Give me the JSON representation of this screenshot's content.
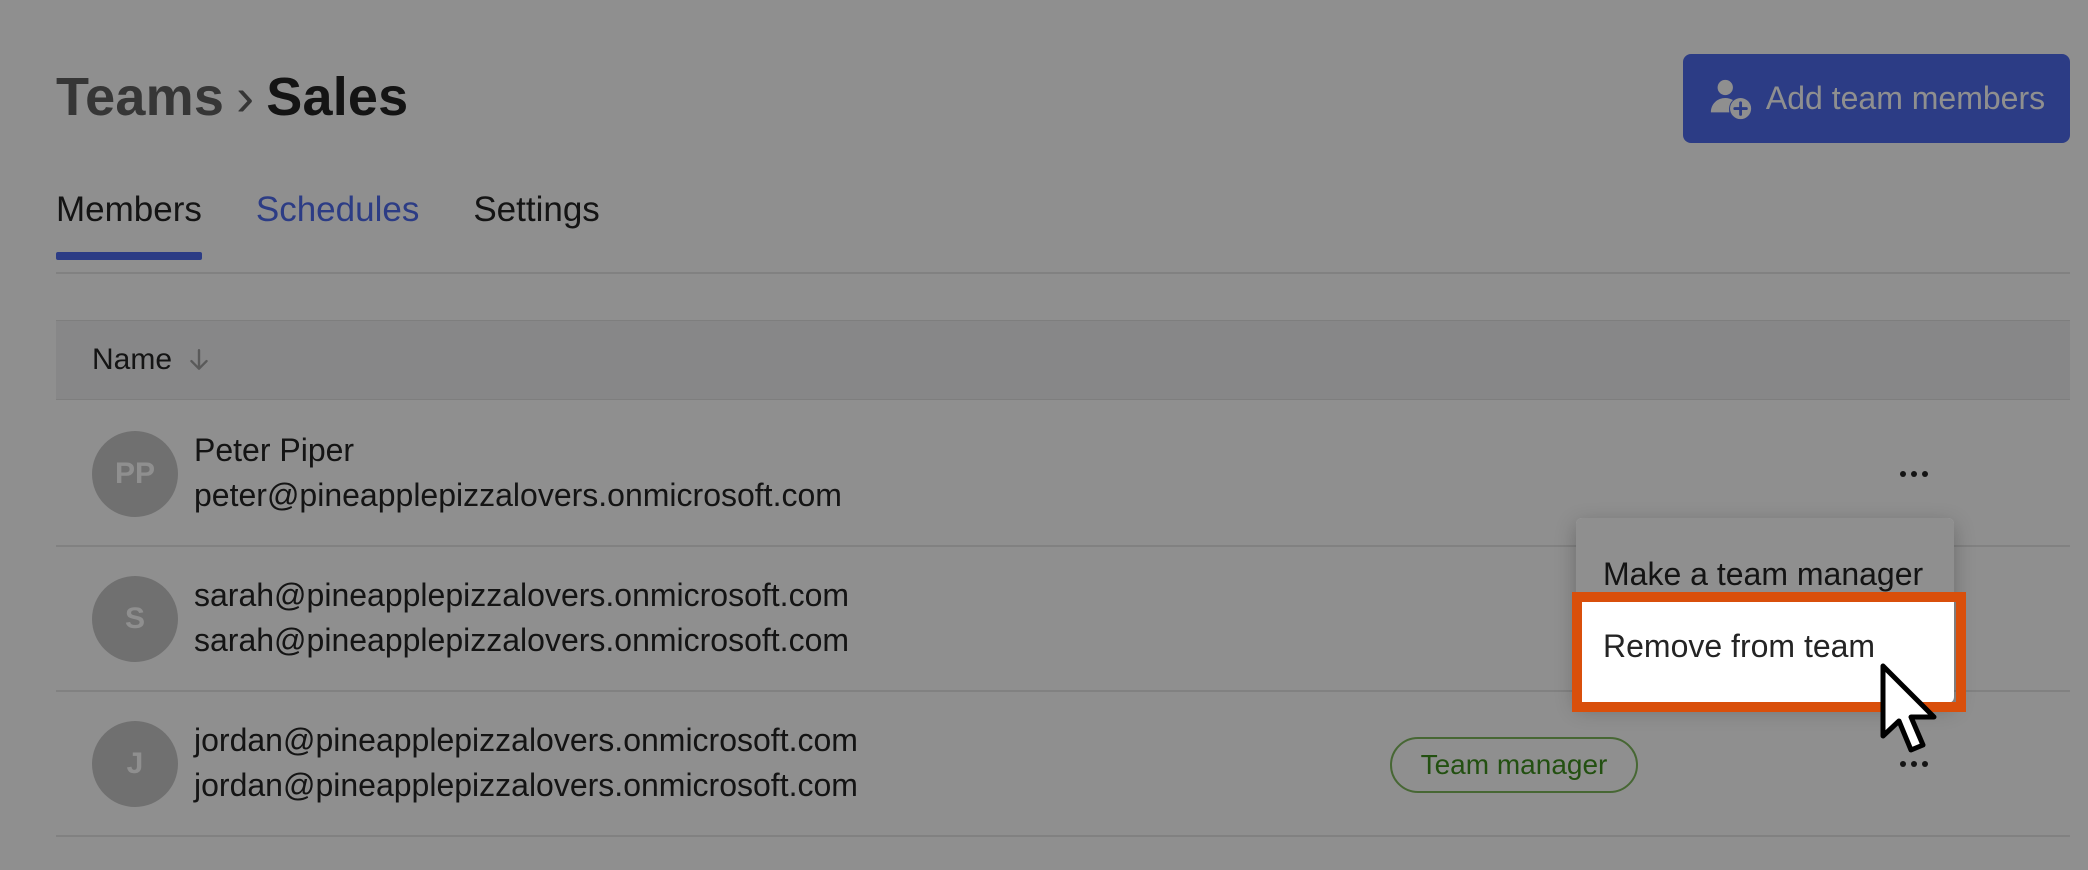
{
  "header": {
    "breadcrumb": {
      "parent": "Teams",
      "separator": "›",
      "current": "Sales"
    },
    "add_button": {
      "label": "Add team members",
      "icon": "person-add-icon"
    }
  },
  "tabs": [
    {
      "label": "Members",
      "active": true
    },
    {
      "label": "Schedules",
      "active": false
    },
    {
      "label": "Settings",
      "active": false
    }
  ],
  "table": {
    "columns": [
      {
        "label": "Name",
        "sort": "descending",
        "icon": "arrow-down-icon"
      }
    ],
    "rows": [
      {
        "initials": "PP",
        "name": "Peter Piper",
        "email": "peter@pineapplepizzalovers.onmicrosoft.com",
        "badge": null
      },
      {
        "initials": "S",
        "name": "sarah@pineapplepizzalovers.onmicrosoft.com",
        "email": "sarah@pineapplepizzalovers.onmicrosoft.com",
        "badge": null
      },
      {
        "initials": "J",
        "name": "jordan@pineapplepizzalovers.onmicrosoft.com",
        "email": "jordan@pineapplepizzalovers.onmicrosoft.com",
        "badge": "Team manager"
      }
    ]
  },
  "context_menu": {
    "items": [
      {
        "label": "Make a team manager"
      },
      {
        "label": "Remove from team",
        "highlighted": true
      }
    ]
  },
  "colors": {
    "accent": "#4f6bed",
    "highlight": "#d94f0b",
    "badge_green": "#3f8f1f"
  }
}
